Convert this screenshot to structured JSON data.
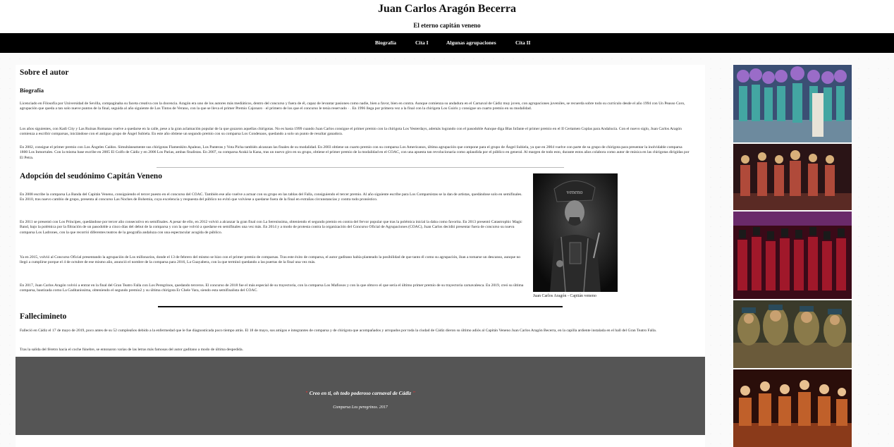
{
  "header": {
    "title": "Juan Carlos Aragón Becerra",
    "subtitle": "El eterno capitán veneno"
  },
  "nav": {
    "items": [
      "Biografía",
      "Cita I",
      "Algunas agrupaciones",
      "Cita II"
    ]
  },
  "about": {
    "heading": "Sobre el autor",
    "subheading": "Biografía",
    "paragraphs": [
      "Licenciado en Filosofía por Universidad de Sevilla, compaginaba su faceta creativa con la docencia. Aragón era uno de los autores más mediáticos, dentro del concurso y fuera de él, capaz de levantar pasiones como nadie, bien a favor, bien en contra. Aunque comienza su andadura en el Carnaval de Cádiz muy joven, con agrupaciones juveniles, se recuerda sobre todo su currículo desde el año 1994 con Un Peasso Coro, agrupación que queda a tan solo nueve puntos de la final, seguida al año siguiente de Los Tintos de Verano, con la que se lleva el primer Premio Cajonaro · el primero de los que el concurso le tenía reservado · . En 1996 llega por primera vez a la final con la chirigota Los Guiris y consigue un cuarto premio en su modalidad.",
      "Los años siguientes, con Kadi City y Las Ruinas Romanas vuelve a quedarse en la calle, pese a la gran aclamación popular de la que gozaron aquellas chirigotas. No es hasta 1999 cuando Juan Carlos consigue el primer premio con la chirigota Los Yesterdays, además logrando con el pasodoble Aunque diga Blas Infante el primer premio en el II Certamen Coplas para Andalucía. Con el nuevo siglo, Juan Carlos Aragón comienza a escribir comparsas, iniciándose con el antiguo grupo de Ángel Subiela. En este año obtiene un segundo premio con su comparsa Los Condenaos, quedando a solo un punto de resultar ganadora.",
      "En 2002, consigue el primer premio con Los Ángeles Caídos. Simultáneamente sus chirigotas Flamenkito Apaleao, Los Panteras y Vota Picha también alcanzan las finales de su modalidad. En 2003 obtiene un cuarto premio con su comparsa Los Americanos, última agrupación que compone para el grupo de Ángel Subiela, ya que en 2004 vuelve con parte de su grupo de chirigota para presentar la inolvidable comparsa 1800 Los Inmortales. Con la misma base escribe en 2005 El Golfo de Cádiz y en 2006 Los Parias, ambas finalistas. En 2007, su comparsa Araká la Kana, tras un nuevo giro en su grupo, obtiene el primer premio de la modalidad en el COAC, con una apuesta tan revolucionaria como aplaudida por el público en general. Al margen de todo esto, durante estos años colabora como autor de música en las chirigotas dirigidas por El Petra."
    ]
  },
  "adoption": {
    "heading": "Adopción del seudónimo Capitán Veneno",
    "paragraphs": [
      "En 2008 escribe la comparsa La Banda del Capitán Veneno, consiguiendo el tercer puesto en el concurso del COAC. También ese año vuelve a actuar con su grupo en las tablas del Falla, consiguiendo el tercer premio. Al año siguiente escribe para Los Comparsistas se la dan de artistas, quedándose solo en semifinales. En 2010, tras nuevo cambio de grupo, presenta al concurso Las Noches de Bohemia, cuya excelencia y respuesta del público no evitó que volviese a quedarse fuera de la final en extrañas circunstancias y contra todo pronóstico.",
      "En 2011 se presentó con Los Príncipes, quedándose por tercer año consecutivo en semifinales. A pesar de ello, en 2012 volvió a alcanzar la gran final con La Serenissima, obteniendo el segundo premio en contra del fervor popular que tras la polémica inicial la daba como favorita. En 2013 presentó Catastrophic Magic Band, bajo la polémica por la filtración de un pasodoble a cinco días del debut de la comparsa y con la que volvió a quedarse en semifinales una vez más. En 2014 y a modo de protesta contra la organización del Concurso Oficial de Agrupaciones (COAC), Juan Carlos decidió presentar fuera de concurso su nueva comparsa Los Ladrones, con la que recorrió diferentes teatros de la geografía andaluza con una espectacular acogida de público.",
      "Ya en 2015, volvió al Concurso Oficial presentando la agrupación de Los millonarios, donde el 13 de febrero del mismo se hizo con el primer premio de comparsas. Tras este éxito de comparsa, el autor gaditano había planteado la posibilidad de que tanto él como su agrupación, iban a tomarse un descanso, aunque no llegó a cumplirse porque el 4 de octubre de ese mismo año, anunció el nombre de la comparsa para 2016, La Guayabera, con la que terminó quedando a las puertas de la final una vez más.",
      "En 2017, Juan Carlos Aragón volvió a entrar en la final del Gran Teatro Falla con Los Peregrinos, quedando terceros. El concurso de 2018 fue el más especial de su trayectoria, con la comparsa Los Mafiosos y con la que obtuvo el que sería el último primer premio de su trayectoria carnavalesca. En 2019, creó su última comparsa, bautizada como La Gaditanissima, obteniendo el segundo premio2 y su última chirigota Er Chele Vara, siendo esta semifinalista del COAC."
    ],
    "caption": "Juan Carlos Aragón - Capitán veneno"
  },
  "death": {
    "heading": "Fallecimineto",
    "paragraphs": [
      "Falleció en Cádiz el 17 de mayo de 2019, poco antes de su 52 cumpleaños debido a la enfermedad que le fue diagnosticada poco tiempo atrás. El 18 de mayo, sus amigos e integrantes de comparsa y de chirigota que acompañados y arropados por toda la ciudad de Cádiz dieron su último adiós al Capitán Veneno Juan Carlos Aragón Becerra, en la capilla ardiente instalada en el hall del Gran Teatro Falla.",
      "Tras la salida del féretro hacia el coche fúnebre, se entonaron varias de las letras más famosas del autor gaditano a modo de última despedida."
    ]
  },
  "quote": {
    "open": "\"",
    "text": "Creo en ti, oh todo poderoso carnaval de Cádiz",
    "close": "\"",
    "source": "Comparsa Los peregrinos. 2017"
  },
  "colors": {
    "nav_bg": "#000000",
    "quote_bg": "#555555",
    "quote_marks": "#ee3333"
  }
}
